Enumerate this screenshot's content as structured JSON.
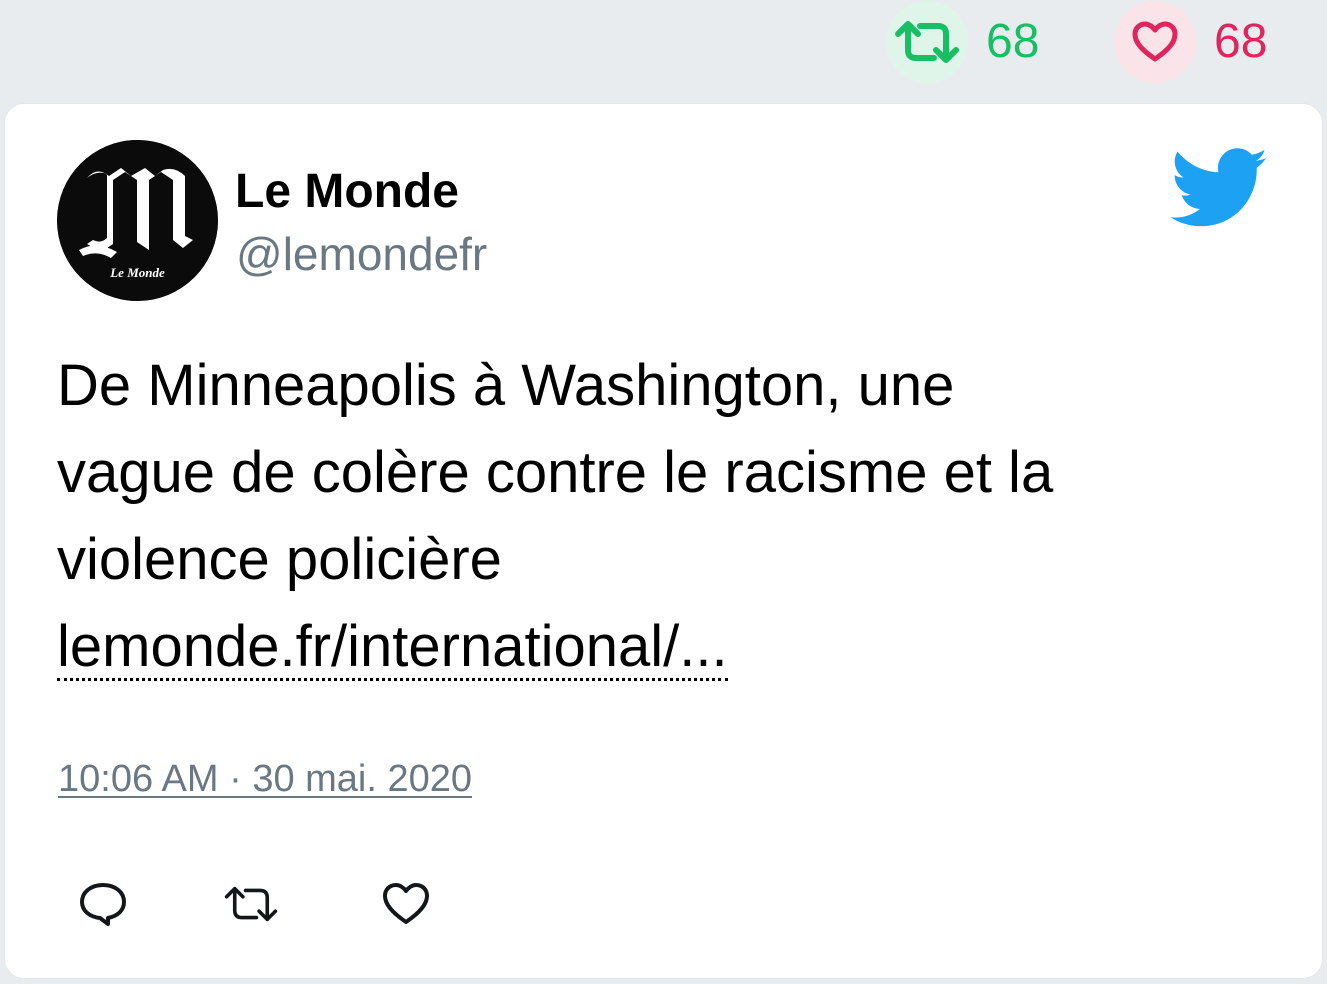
{
  "stats": {
    "retweet_icon": "retweet-icon",
    "retweet_count": "68",
    "like_icon": "heart-icon",
    "like_count": "68",
    "retweet_color": "#17bf63",
    "like_color": "#e0245e"
  },
  "tweet": {
    "author_name": "Le Monde",
    "author_handle": "@lemondefr",
    "avatar_icon": "le-monde-logo",
    "brand_icon": "twitter-bird-icon",
    "text_lines": [
      "De Minneapolis à Washington, une",
      "vague de colère contre le racisme et la",
      "violence policière"
    ],
    "link": "lemonde.fr/international/...",
    "timestamp": "10:06 AM · 30 mai. 2020"
  },
  "actions": {
    "reply_icon": "reply-icon",
    "retweet_icon": "retweet-icon",
    "like_icon": "heart-icon"
  },
  "colors": {
    "twitter_blue": "#1da1f2",
    "muted_text": "#697882",
    "background": "#e9ecef"
  }
}
